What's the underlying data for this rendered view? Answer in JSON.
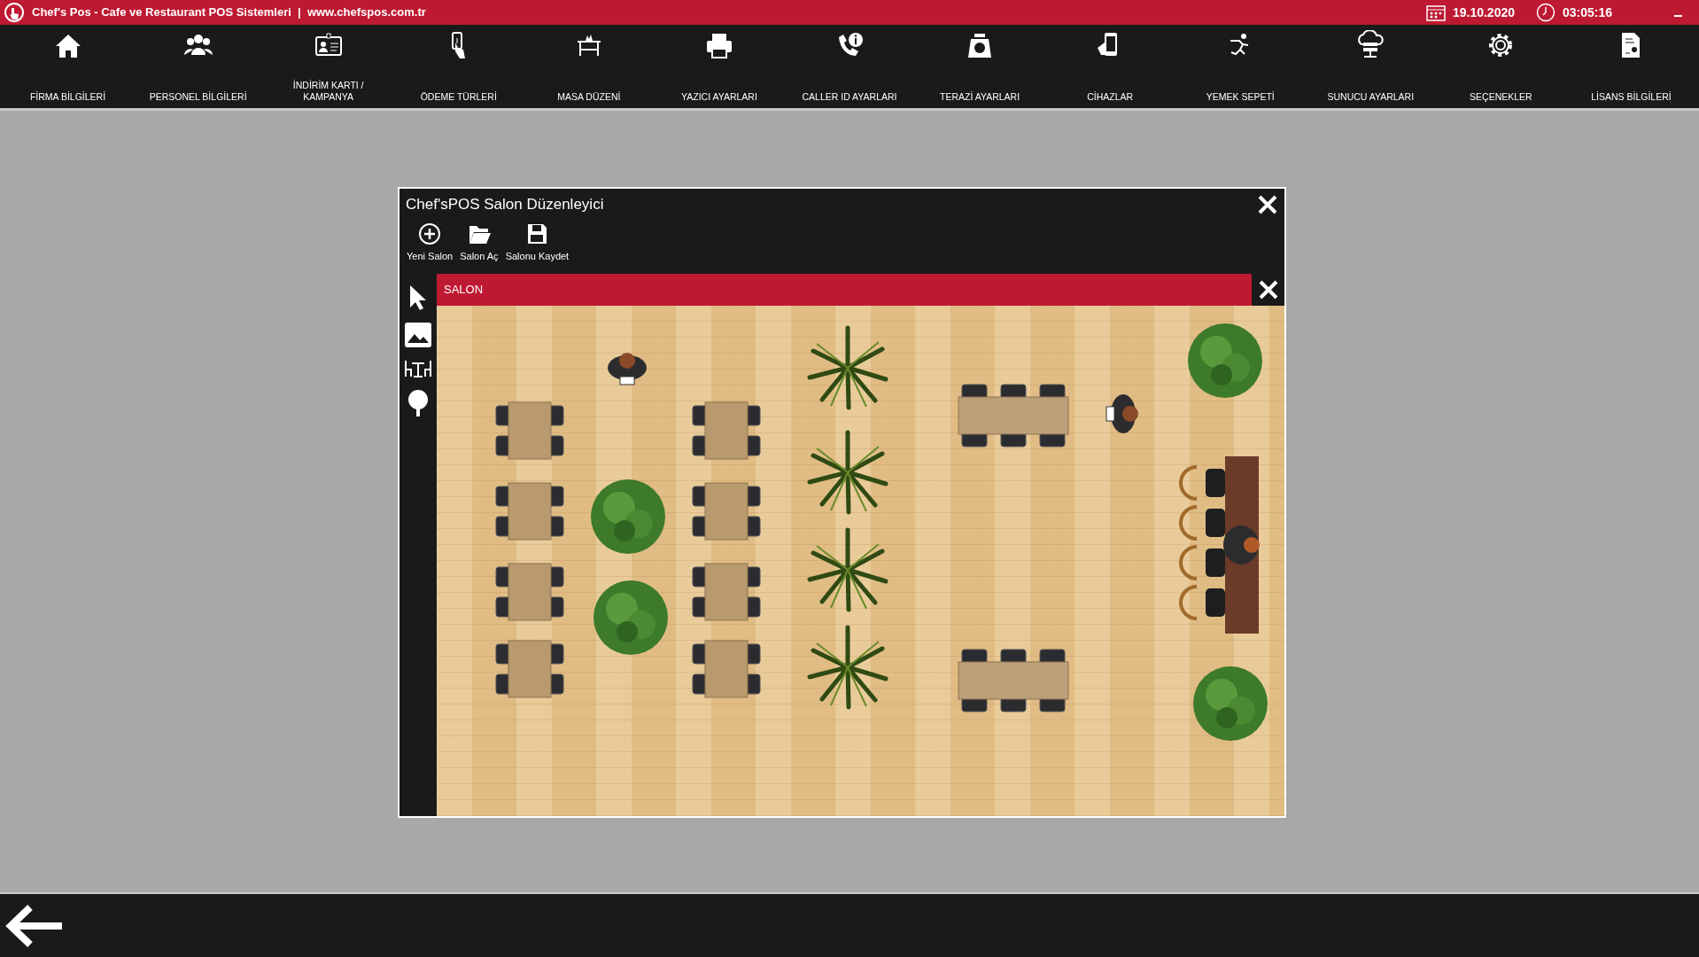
{
  "title_bar": {
    "app_title": "Chef's Pos - Cafe ve Restaurant POS Sistemleri  |  www.chefspos.com.tr",
    "date": "19.10.2020",
    "time": "03:05:16"
  },
  "nav": [
    {
      "kind": "home",
      "label": "FİRMA BİLGİLERİ"
    },
    {
      "kind": "people",
      "label": "PERSONEL BİLGİLERİ"
    },
    {
      "kind": "card",
      "label": "İNDİRİM KARTI / KAMPANYA"
    },
    {
      "kind": "payment",
      "label": "ÖDEME TÜRLERİ"
    },
    {
      "kind": "table",
      "label": "MASA DÜZENİ"
    },
    {
      "kind": "printer",
      "label": "YAZICI AYARLARI"
    },
    {
      "kind": "phone",
      "label": "CALLER ID AYARLARI"
    },
    {
      "kind": "scale",
      "label": "TERAZİ AYARLARI"
    },
    {
      "kind": "device",
      "label": "CİHAZLAR"
    },
    {
      "kind": "runner",
      "label": "YEMEK SEPETİ"
    },
    {
      "kind": "server",
      "label": "SUNUCU AYARLARI"
    },
    {
      "kind": "gear",
      "label": "SEÇENEKLER"
    },
    {
      "kind": "license",
      "label": "LİSANS BİLGİLERİ"
    }
  ],
  "dialog": {
    "title": "Chef'sPOS Salon Düzenleyici",
    "toolbar": [
      {
        "kind": "new",
        "label": "Yeni Salon"
      },
      {
        "kind": "open",
        "label": "Salon Aç"
      },
      {
        "kind": "save",
        "label": "Salonu Kaydet"
      }
    ],
    "tab": {
      "label": "SALON"
    }
  }
}
